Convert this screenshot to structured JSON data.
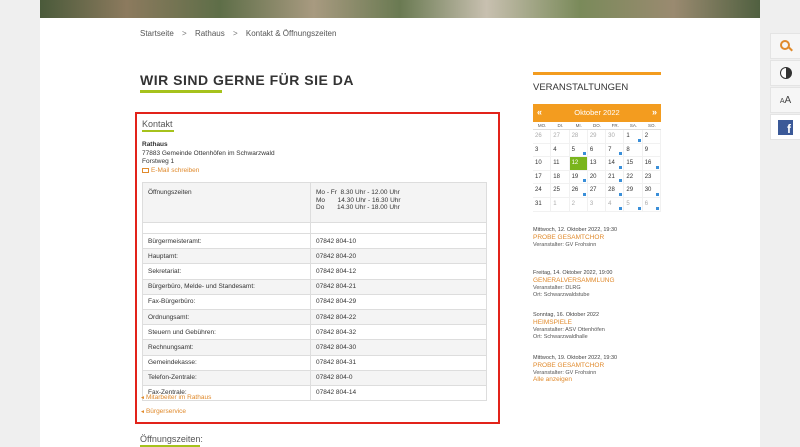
{
  "breadcrumb": [
    "Startseite",
    "Rathaus",
    "Kontakt & Öffnungszeiten"
  ],
  "breadcrumb_separator": ">",
  "page_title": "WIR SIND GERNE FÜR SIE DA",
  "kontakt": {
    "heading": "Kontakt",
    "name": "Rathaus",
    "address_line1": "77883 Gemeinde Ottenhöfen im Schwarzwald",
    "address_line2": "Forstweg 1",
    "email_label": "E-Mail schreiben",
    "hours_label": "Öffnungszeiten",
    "hours_lines": [
      "Mo - Fr  8.30 Uhr - 12.00 Uhr",
      "Mo       14.30 Uhr - 16.30 Uhr",
      "Do       14.30 Uhr - 18.00 Uhr"
    ],
    "phones": [
      {
        "label": "Bürgermeisteramt:",
        "number": "07842 804-10"
      },
      {
        "label": "Hauptamt:",
        "number": "07842 804-20"
      },
      {
        "label": "Sekretariat:",
        "number": "07842 804-12"
      },
      {
        "label": "Bürgerbüro, Melde- und Standesamt:",
        "number": "07842 804-21"
      },
      {
        "label": "Fax-Bürgerbüro:",
        "number": "07842 804-29"
      },
      {
        "label": "Ordnungsamt:",
        "number": "07842 804-22"
      },
      {
        "label": "Steuern und Gebühren:",
        "number": "07842 804-32"
      },
      {
        "label": "Rechnungsamt:",
        "number": "07842 804-30"
      },
      {
        "label": "Gemeindekasse:",
        "number": "07842 804-31"
      },
      {
        "label": "Telefon-Zentrale:",
        "number": "07842 804-0"
      },
      {
        "label": "Fax-Zentrale:",
        "number": "07842 804-14"
      }
    ],
    "links": [
      "Mitarbeiter im Rathaus",
      "Bürgerservice"
    ]
  },
  "oeffnungszeiten_heading": "Öffnungszeiten:",
  "sidebar": {
    "title": "VERANSTALTUNGEN",
    "calendar": {
      "month": "Oktober 2022",
      "prev": "«",
      "next": "»",
      "weekdays": [
        "MO.",
        "DI.",
        "MI.",
        "DO.",
        "FR.",
        "SA.",
        "SO."
      ],
      "days": [
        {
          "d": "26",
          "other": true
        },
        {
          "d": "27",
          "other": true
        },
        {
          "d": "28",
          "other": true
        },
        {
          "d": "29",
          "other": true
        },
        {
          "d": "30",
          "other": true
        },
        {
          "d": "1",
          "ev": true
        },
        {
          "d": "2"
        },
        {
          "d": "3"
        },
        {
          "d": "4"
        },
        {
          "d": "5",
          "ev": true
        },
        {
          "d": "6"
        },
        {
          "d": "7",
          "ev": true
        },
        {
          "d": "8"
        },
        {
          "d": "9"
        },
        {
          "d": "10"
        },
        {
          "d": "11"
        },
        {
          "d": "12",
          "today": true
        },
        {
          "d": "13"
        },
        {
          "d": "14",
          "ev": true
        },
        {
          "d": "15"
        },
        {
          "d": "16",
          "ev": true
        },
        {
          "d": "17"
        },
        {
          "d": "18"
        },
        {
          "d": "19",
          "ev": true
        },
        {
          "d": "20"
        },
        {
          "d": "21",
          "ev": true
        },
        {
          "d": "22"
        },
        {
          "d": "23"
        },
        {
          "d": "24"
        },
        {
          "d": "25"
        },
        {
          "d": "26",
          "ev": true
        },
        {
          "d": "27"
        },
        {
          "d": "28",
          "ev": true
        },
        {
          "d": "29"
        },
        {
          "d": "30",
          "ev": true
        },
        {
          "d": "31"
        },
        {
          "d": "1",
          "other": true
        },
        {
          "d": "2",
          "other": true
        },
        {
          "d": "3",
          "other": true
        },
        {
          "d": "4",
          "other": true,
          "ev": true
        },
        {
          "d": "5",
          "other": true,
          "ev": true
        },
        {
          "d": "6",
          "other": true,
          "ev": true
        }
      ]
    },
    "events": [
      {
        "date": "Mittwoch, 12. Oktober 2022, 19:30",
        "title": "PROBE GESAMTCHOR",
        "meta": [
          "Veranstalter: GV Frohsinn"
        ]
      },
      {
        "date": "Freitag, 14. Oktober 2022, 19:00",
        "title": "GENERALVERSAMMLUNG",
        "meta": [
          "Veranstalter: DLRG",
          "Ort: Schwarzwaldstube"
        ]
      },
      {
        "date": "Sonntag, 16. Oktober 2022",
        "title": "HEIMSPIELE",
        "meta": [
          "Veranstalter: ASV Ottenhöfen",
          "Ort: Schwarzwaldhalle"
        ]
      },
      {
        "date": "Mittwoch, 19. Oktober 2022, 19:30",
        "title": "PROBE GESAMTCHOR",
        "meta": [
          "Veranstalter: GV Frohsinn"
        ]
      }
    ],
    "all_events": "Alle anzeigen"
  },
  "tools": {
    "fontsize_small": "A",
    "fontsize_large": "A",
    "facebook": "f"
  },
  "colors": {
    "accent_green": "#a6c21c",
    "accent_orange": "#f39c1f",
    "link_orange": "#e08a2c",
    "highlight_red": "#e2231a",
    "today_green": "#7ab51d"
  }
}
